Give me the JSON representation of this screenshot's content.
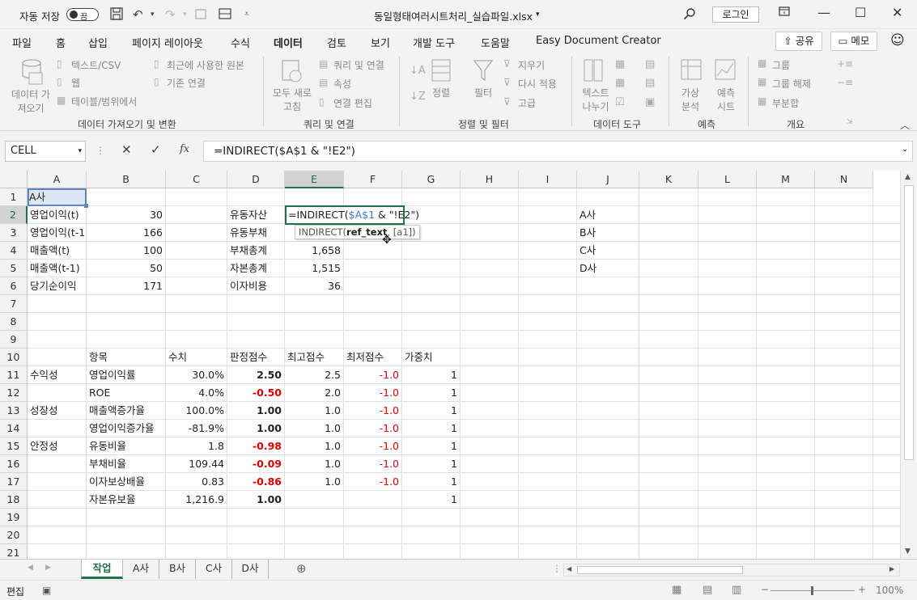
{
  "titlebar": {
    "autosave_label": "자동 저장",
    "autosave_state": "끔",
    "filename": "동일형태여러시트처리_실습파일.xlsx",
    "login_label": "로그인"
  },
  "menu": {
    "tabs": [
      "파일",
      "홈",
      "삽입",
      "페이지 레이아웃",
      "수식",
      "데이터",
      "검토",
      "보기",
      "개발 도구",
      "도움말",
      "Easy Document Creator"
    ],
    "active_tab": "데이터",
    "share_label": "공유",
    "memo_label": "메모"
  },
  "ribbon": {
    "get_data_btn": "데이터 가\n져오기",
    "text_csv": "텍스트/CSV",
    "web": "웹",
    "table_range": "테이블/범위에서",
    "recent_sources": "최근에 사용한 원본",
    "existing_conn": "기존 연결",
    "group1_label": "데이터 가져오기 및 변환",
    "refresh_all": "모두 새로\n고침",
    "queries_conn": "쿼리 및 연결",
    "properties": "속성",
    "edit_links": "연결 편집",
    "group2_label": "쿼리 및 연결",
    "sort": "정렬",
    "filter": "필터",
    "clear": "지우기",
    "reapply": "다시 적용",
    "advanced": "고급",
    "group3_label": "정렬 및 필터",
    "text_to_columns": "텍스트\n나누기",
    "group4_label": "데이터 도구",
    "whatif": "가상\n분석",
    "forecast_sheet": "예측\n시트",
    "group5_label": "예측",
    "group_btn": "그룹",
    "ungroup_btn": "그룹 해제",
    "subtotal": "부분합",
    "group6_label": "개요"
  },
  "formula_bar": {
    "name_box": "CELL",
    "formula": "=INDIRECT($A$1 & \"!E2\")"
  },
  "columns": [
    "A",
    "B",
    "C",
    "D",
    "E",
    "F",
    "G",
    "H",
    "I",
    "J",
    "K",
    "L",
    "M",
    "N"
  ],
  "rows": [
    "1",
    "2",
    "3",
    "4",
    "5",
    "6",
    "7",
    "8",
    "9",
    "10",
    "11",
    "12",
    "13",
    "14",
    "15",
    "16",
    "17",
    "18",
    "19",
    "20",
    "21"
  ],
  "cells": {
    "A1": "A사",
    "A2": "영업이익(t)",
    "B2": "30",
    "D2": "유동자산",
    "A3": "영업이익(t-1",
    "B3": "166",
    "D3": "유동부채",
    "A4": "매출액(t)",
    "B4": "100",
    "D4": "부채총계",
    "E4": "1,658",
    "A5": "매출액(t-1)",
    "B5": "50",
    "D5": "자본총계",
    "E5": "1,515",
    "A6": "당기순이익",
    "B6": "171",
    "D6": "이자비용",
    "E6": "36",
    "J2": "A사",
    "J3": "B사",
    "J4": "C사",
    "J5": "D사",
    "B10": "항목",
    "C10": "수치",
    "D10": "판정점수",
    "E10": "최고점수",
    "F10": "최저점수",
    "G10": "가중치",
    "A11": "수익성",
    "B11": "영업이익률",
    "C11": "30.0%",
    "D11": "2.50",
    "E11": "2.5",
    "F11": "-1.0",
    "G11": "1",
    "B12": "ROE",
    "C12": "4.0%",
    "D12": "-0.50",
    "E12": "2.0",
    "F12": "-1.0",
    "G12": "1",
    "A13": "성장성",
    "B13": "매출액증가율",
    "C13": "100.0%",
    "D13": "1.00",
    "E13": "1.0",
    "F13": "-1.0",
    "G13": "1",
    "B14": "영업이익증가율",
    "C14": "-81.9%",
    "D14": "1.00",
    "E14": "1.0",
    "F14": "-1.0",
    "G14": "1",
    "A15": "안정성",
    "B15": "유동비율",
    "C15": "1.8",
    "D15": "-0.98",
    "E15": "1.0",
    "F15": "-1.0",
    "G15": "1",
    "B16": "부채비율",
    "C16": "109.44",
    "D16": "-0.09",
    "E16": "1.0",
    "F16": "-1.0",
    "G16": "1",
    "B17": "이자보상배율",
    "C17": "0.83",
    "D17": "-0.86",
    "E17": "1.0",
    "F17": "-1.0",
    "G17": "1",
    "B18": "자본유보율",
    "C18": "1,216.9",
    "D18": "1.00",
    "G18": "1"
  },
  "editing_cell": {
    "part1": "=INDIRECT(",
    "ref": "$A$1",
    "part2": " & \"!E2\")"
  },
  "tooltip": {
    "fn": "INDIRECT(",
    "arg1": "ref_text",
    "rest": ", [a1])"
  },
  "sheets": [
    "작업",
    "A사",
    "B사",
    "C사",
    "D사"
  ],
  "active_sheet": "작업",
  "status": {
    "mode": "편집",
    "zoom": "100%"
  },
  "colors": {
    "excel_green": "#217346",
    "negative_red": "#e00000",
    "ref_blue": "#3c78d8"
  }
}
